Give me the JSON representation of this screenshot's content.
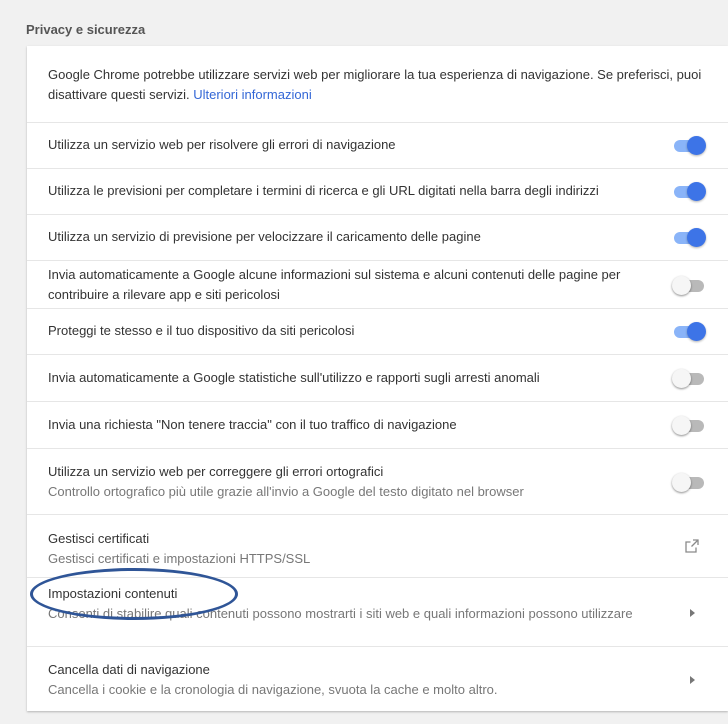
{
  "section": {
    "title": "Privacy e sicurezza"
  },
  "intro": {
    "text": "Google Chrome potrebbe utilizzare servizi web per migliorare la tua esperienza di navigazione. Se preferisci, puoi disattivare questi servizi. ",
    "link": "Ulteriori informazioni"
  },
  "settings": [
    {
      "label": "Utilizza un servizio web per risolvere gli errori di navigazione",
      "sub": "",
      "state": "on"
    },
    {
      "label": "Utilizza le previsioni per completare i termini di ricerca e gli URL digitati nella barra degli indirizzi",
      "sub": "",
      "state": "on"
    },
    {
      "label": "Utilizza un servizio di previsione per velocizzare il caricamento delle pagine",
      "sub": "",
      "state": "on"
    },
    {
      "label": "Invia automaticamente a Google alcune informazioni sul sistema e alcuni contenuti delle pagine per contribuire a rilevare app e siti pericolosi",
      "sub": "",
      "state": "off"
    },
    {
      "label": "Proteggi te stesso e il tuo dispositivo da siti pericolosi",
      "sub": "",
      "state": "on"
    },
    {
      "label": "Invia automaticamente a Google statistiche sull'utilizzo e rapporti sugli arresti anomali",
      "sub": "",
      "state": "off"
    },
    {
      "label": "Invia una richiesta \"Non tenere traccia\" con il tuo traffico di navigazione",
      "sub": "",
      "state": "off"
    },
    {
      "label": "Utilizza un servizio web per correggere gli errori ortografici",
      "sub": "Controllo ortografico più utile grazie all'invio a Google del testo digitato nel browser",
      "state": "off"
    }
  ],
  "links": [
    {
      "label": "Gestisci certificati",
      "sub": "Gestisci certificati e impostazioni HTTPS/SSL",
      "icon": "open-in-new-icon"
    },
    {
      "label": "Impostazioni contenuti",
      "sub": "Consenti di stabilire quali contenuti possono mostrarti i siti web e quali informazioni possono utilizzare",
      "icon": "chevron-right-icon"
    },
    {
      "label": "Cancella dati di navigazione",
      "sub": "Cancella i cookie e la cronologia di navigazione, svuota la cache e molto altro.",
      "icon": "chevron-right-icon"
    }
  ],
  "colors": {
    "accent": "#3d74e7",
    "link": "#3367d6",
    "annotation": "#2f5597"
  }
}
